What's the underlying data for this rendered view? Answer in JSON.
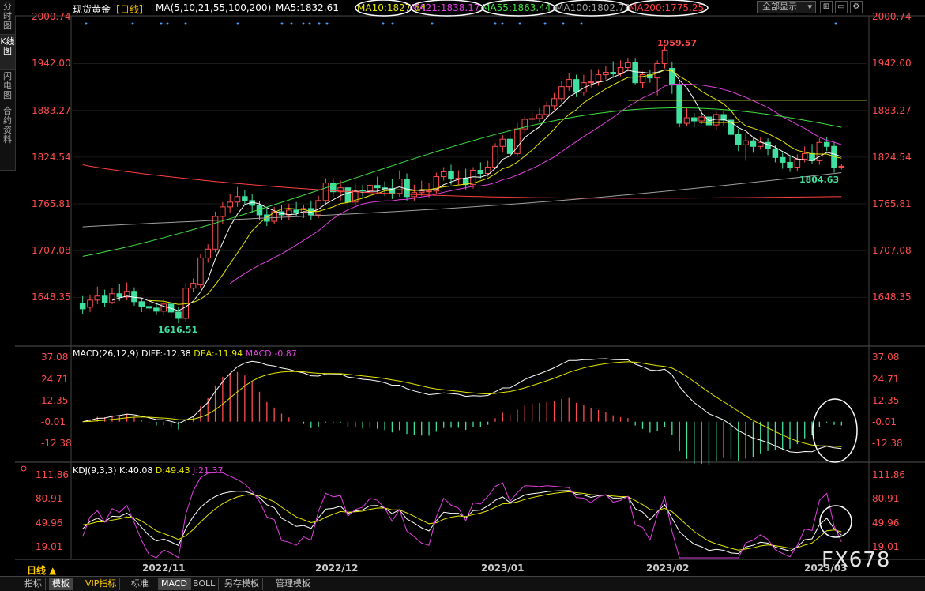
{
  "sidebar": {
    "tabs": [
      {
        "label": "分时图",
        "active": false
      },
      {
        "label": "K线图",
        "active": true
      },
      {
        "label": "闪电图",
        "active": false
      },
      {
        "label": "合约资料",
        "active": false
      }
    ]
  },
  "header": {
    "instrument": "现货黄金",
    "period": "【日线】",
    "ma_legend": [
      {
        "text": "MA(5,10,21,55,100,200)",
        "color": "#ffffff"
      },
      {
        "text": "MA5:1832.61",
        "color": "#ffffff"
      },
      {
        "text": "MA10:1827.64",
        "color": "#e6e600"
      },
      {
        "text": "MA21:1838.17",
        "color": "#e040e0"
      },
      {
        "text": "MA55:1863.44",
        "color": "#40e040"
      },
      {
        "text": "MA100:1802.72",
        "color": "#a0a0a0"
      },
      {
        "text": "MA200:1775.25",
        "color": "#ff4040"
      }
    ],
    "range_select": "全部显示"
  },
  "price_axis": [
    "2000.74",
    "1942.00",
    "1883.27",
    "1824.54",
    "1765.81",
    "1707.08",
    "1648.35"
  ],
  "annotations": {
    "high": "1959.57",
    "low": "1616.51",
    "recent_low": "1804.63"
  },
  "macd": {
    "title": "MACD(26,12,9)",
    "diff": "DIFF:-12.38",
    "dea": "DEA:-11.94",
    "macd": "MACD:-0.87",
    "axis": [
      "37.08",
      "24.71",
      "12.35",
      "-0.01",
      "-12.38"
    ]
  },
  "kdj": {
    "title": "KDJ(9,3,3)",
    "k": "K:40.08",
    "d": "D:49.43",
    "j": "J:21.37",
    "axis": [
      "111.86",
      "80.91",
      "49.96",
      "19.01"
    ]
  },
  "x_axis": [
    "2022/11",
    "2022/12",
    "2023/01",
    "2023/02",
    "2023/03"
  ],
  "bottom": {
    "period_label": "日线 ▲",
    "tabs": [
      {
        "label": "指标",
        "selected": false
      },
      {
        "label": "模板",
        "selected": true
      },
      {
        "label": "VIP指标",
        "selected": false
      },
      {
        "label": "标准",
        "selected": false
      },
      {
        "label": "MACD",
        "selected": true
      },
      {
        "label": "BOLL",
        "selected": false
      },
      {
        "label": "另存模板",
        "selected": false
      },
      {
        "label": "管理模板",
        "selected": false
      }
    ]
  },
  "watermark": "FX678",
  "colors": {
    "up": "#ff4d4d",
    "down": "#40e0a0",
    "ma5": "#ffffff",
    "ma10": "#e6e600",
    "ma21": "#e040e0",
    "ma55": "#40e040",
    "ma100": "#a0a0a0",
    "ma200": "#ff4040"
  },
  "chart_data": {
    "type": "candlestick",
    "ylim": [
      1620,
      2000
    ],
    "candles": [
      [
        1641,
        1634,
        1650,
        1628
      ],
      [
        1636,
        1645,
        1652,
        1630
      ],
      [
        1645,
        1650,
        1662,
        1640
      ],
      [
        1650,
        1642,
        1658,
        1636
      ],
      [
        1642,
        1653,
        1660,
        1640
      ],
      [
        1653,
        1649,
        1665,
        1644
      ],
      [
        1649,
        1656,
        1667,
        1645
      ],
      [
        1656,
        1643,
        1661,
        1638
      ],
      [
        1643,
        1637,
        1648,
        1630
      ],
      [
        1637,
        1635,
        1646,
        1631
      ],
      [
        1635,
        1631,
        1641,
        1626
      ],
      [
        1631,
        1640,
        1646,
        1626
      ],
      [
        1640,
        1630,
        1645,
        1622
      ],
      [
        1630,
        1622,
        1636,
        1616
      ],
      [
        1622,
        1660,
        1666,
        1618
      ],
      [
        1660,
        1666,
        1672,
        1655
      ],
      [
        1664,
        1698,
        1703,
        1660
      ],
      [
        1698,
        1709,
        1715,
        1692
      ],
      [
        1709,
        1750,
        1756,
        1705
      ],
      [
        1750,
        1762,
        1768,
        1740
      ],
      [
        1762,
        1768,
        1778,
        1755
      ],
      [
        1768,
        1775,
        1787,
        1762
      ],
      [
        1775,
        1770,
        1783,
        1764
      ],
      [
        1770,
        1764,
        1778,
        1755
      ],
      [
        1764,
        1752,
        1769,
        1745
      ],
      [
        1752,
        1744,
        1760,
        1738
      ],
      [
        1744,
        1756,
        1762,
        1740
      ],
      [
        1756,
        1752,
        1764,
        1745
      ],
      [
        1752,
        1758,
        1766,
        1746
      ],
      [
        1758,
        1755,
        1768,
        1750
      ],
      [
        1755,
        1760,
        1765,
        1748
      ],
      [
        1760,
        1752,
        1770,
        1745
      ],
      [
        1752,
        1770,
        1776,
        1748
      ],
      [
        1770,
        1792,
        1798,
        1764
      ],
      [
        1792,
        1781,
        1798,
        1775
      ],
      [
        1781,
        1786,
        1795,
        1770
      ],
      [
        1786,
        1768,
        1790,
        1760
      ],
      [
        1768,
        1783,
        1792,
        1762
      ],
      [
        1783,
        1782,
        1790,
        1774
      ],
      [
        1782,
        1789,
        1795,
        1778
      ],
      [
        1789,
        1786,
        1800,
        1780
      ],
      [
        1786,
        1785,
        1794,
        1776
      ],
      [
        1785,
        1779,
        1797,
        1772
      ],
      [
        1779,
        1797,
        1808,
        1775
      ],
      [
        1797,
        1775,
        1804,
        1770
      ],
      [
        1775,
        1780,
        1790,
        1770
      ],
      [
        1780,
        1782,
        1795,
        1776
      ],
      [
        1782,
        1782,
        1792,
        1774
      ],
      [
        1782,
        1800,
        1805,
        1778
      ],
      [
        1800,
        1806,
        1812,
        1795
      ],
      [
        1806,
        1797,
        1815,
        1790
      ],
      [
        1797,
        1798,
        1808,
        1790
      ],
      [
        1798,
        1790,
        1810,
        1784
      ],
      [
        1790,
        1808,
        1812,
        1785
      ],
      [
        1808,
        1804,
        1818,
        1798
      ],
      [
        1804,
        1812,
        1820,
        1800
      ],
      [
        1812,
        1838,
        1842,
        1810
      ],
      [
        1838,
        1847,
        1852,
        1830
      ],
      [
        1847,
        1829,
        1858,
        1825
      ],
      [
        1829,
        1860,
        1867,
        1826
      ],
      [
        1860,
        1872,
        1876,
        1854
      ],
      [
        1872,
        1873,
        1882,
        1866
      ],
      [
        1873,
        1878,
        1886,
        1868
      ],
      [
        1878,
        1889,
        1895,
        1872
      ],
      [
        1889,
        1898,
        1905,
        1884
      ],
      [
        1898,
        1913,
        1920,
        1894
      ],
      [
        1913,
        1922,
        1930,
        1908
      ],
      [
        1922,
        1906,
        1928,
        1900
      ],
      [
        1906,
        1918,
        1928,
        1902
      ],
      [
        1918,
        1919,
        1935,
        1912
      ],
      [
        1919,
        1928,
        1935,
        1914
      ],
      [
        1928,
        1931,
        1939,
        1922
      ],
      [
        1931,
        1929,
        1945,
        1924
      ],
      [
        1929,
        1937,
        1946,
        1926
      ],
      [
        1937,
        1943,
        1949,
        1932
      ],
      [
        1943,
        1918,
        1948,
        1916
      ],
      [
        1918,
        1928,
        1932,
        1911
      ],
      [
        1928,
        1924,
        1934,
        1918
      ],
      [
        1924,
        1942,
        1946,
        1902
      ],
      [
        1942,
        1959,
        1964,
        1936
      ],
      [
        1936,
        1915,
        1944,
        1904
      ],
      [
        1915,
        1867,
        1920,
        1862
      ],
      [
        1867,
        1874,
        1886,
        1864
      ],
      [
        1874,
        1870,
        1880,
        1862
      ],
      [
        1870,
        1875,
        1884,
        1866
      ],
      [
        1875,
        1865,
        1890,
        1860
      ],
      [
        1865,
        1878,
        1882,
        1858
      ],
      [
        1878,
        1871,
        1883,
        1864
      ],
      [
        1871,
        1853,
        1878,
        1849
      ],
      [
        1853,
        1840,
        1860,
        1832
      ],
      [
        1840,
        1845,
        1855,
        1820
      ],
      [
        1845,
        1838,
        1850,
        1830
      ],
      [
        1838,
        1843,
        1850,
        1834
      ],
      [
        1843,
        1835,
        1848,
        1827
      ],
      [
        1835,
        1824,
        1840,
        1818
      ],
      [
        1824,
        1818,
        1830,
        1810
      ],
      [
        1818,
        1812,
        1826,
        1806
      ],
      [
        1812,
        1822,
        1828,
        1807
      ],
      [
        1822,
        1829,
        1838,
        1818
      ],
      [
        1829,
        1820,
        1841,
        1816
      ],
      [
        1820,
        1843,
        1848,
        1815
      ],
      [
        1843,
        1838,
        1850,
        1832
      ],
      [
        1838,
        1812,
        1844,
        1805
      ],
      [
        1812,
        1813,
        1816,
        1809
      ]
    ]
  }
}
